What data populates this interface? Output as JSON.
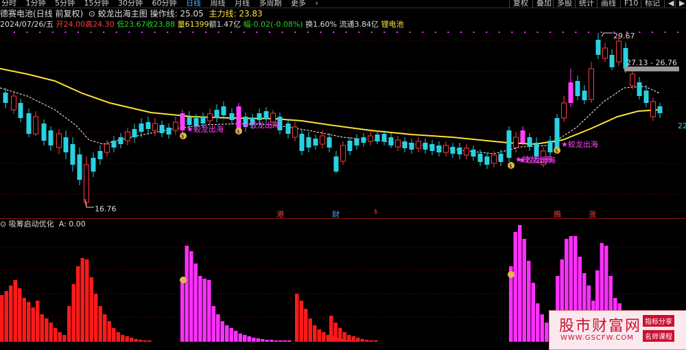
{
  "toolbar": {
    "periods": [
      "分时",
      "1分钟",
      "5分钟",
      "15分钟",
      "30分钟",
      "60分钟",
      "日线",
      "周线",
      "月线",
      "多周期",
      "更多"
    ],
    "right_buttons": [
      "复权",
      "叠加",
      "多股",
      "统计",
      "画线",
      "F10",
      "标记"
    ]
  },
  "title": {
    "stock": "德赛电池",
    "mode": "(日线 前复权)",
    "indicator": "蛟龙出海主图",
    "op_label": "操作线:",
    "op_value": "25.05",
    "main_label": "主力线:",
    "main_value": "23.83"
  },
  "info": {
    "date": "2024/07/26/五",
    "open": "开24.00",
    "high": "高24.30",
    "low": "低23.67",
    "close": "收23.88",
    "volume": "量61399",
    "amount": "额1.47亿",
    "change": "幅-0.02(-0.08%)",
    "turnover": "换1.60%",
    "float": "流通3.84亿",
    "sector": "锂电池"
  },
  "annotations": {
    "high_price": "29.67",
    "low_price": "16.76",
    "range_box": "27.13 - 26.76",
    "right_edge": "22",
    "signal": "蛟龙出海",
    "events": [
      "港",
      "财",
      "$",
      "腾",
      "涨"
    ]
  },
  "sub": {
    "name": "吸筹启动优化",
    "value": "A: 0.00"
  },
  "watermark": {
    "title": "股市财富网",
    "url": "WWW.GSCFW.COM",
    "badge1": "指标分享",
    "badge2": "名师课程"
  },
  "colors": {
    "up": "#ff3b3b",
    "down": "#2ad1e0",
    "ma_yellow": "#ffe135",
    "signal_magenta": "#ff40ff"
  }
}
